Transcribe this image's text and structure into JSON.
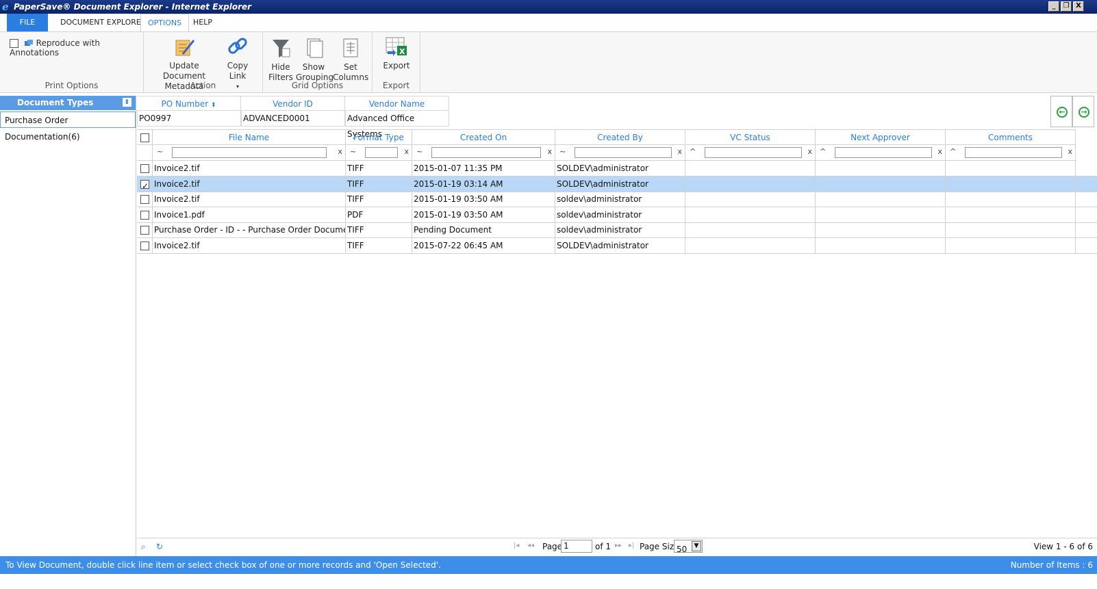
{
  "window": {
    "title": "PaperSave® Document Explorer - Internet Explorer",
    "controls": [
      "_",
      "❐",
      "X"
    ]
  },
  "menu": {
    "tabs": [
      {
        "label": "FILE",
        "active": false
      },
      {
        "label": "DOCUMENT EXPLORER",
        "active": false
      },
      {
        "label": "OPTIONS",
        "active": true
      },
      {
        "label": "HELP",
        "active": false
      }
    ]
  },
  "ribbon": {
    "print_options": {
      "reproduce_label": "Reproduce with Annotations",
      "reproduce_checked": false,
      "group_label": "Print Options"
    },
    "action": {
      "update_metadata_line1": "Update Document",
      "update_metadata_line2": "Metadata",
      "copy_link_line1": "Copy",
      "copy_link_line2": "Link",
      "copy_link_arrow": "▾",
      "group_label": "Action"
    },
    "grid_options": {
      "hide_filters_line1": "Hide",
      "hide_filters_line2": "Filters",
      "show_grouping_line1": "Show",
      "show_grouping_line2": "Grouping",
      "set_columns_line1": "Set",
      "set_columns_line2": "Columns",
      "group_label": "Grid Options"
    },
    "export": {
      "export_label": "Export",
      "group_label": "Export"
    }
  },
  "left_panel": {
    "header": "Document Types",
    "pin_icon": "pin-icon",
    "items": [
      "Purchase Order Documentation(6)"
    ]
  },
  "header_grid": {
    "columns": [
      "PO Number",
      "Vendor ID",
      "Vendor Name"
    ],
    "sort_glyph": "⬍",
    "values": [
      "PO0997",
      "ADVANCED0001",
      "Advanced Office Systems"
    ]
  },
  "nav": {
    "prev_icon": "arrow-left-circle-icon",
    "next_icon": "arrow-right-circle-icon",
    "prev_glyph": "←",
    "next_glyph": "→"
  },
  "grid": {
    "columns": [
      "File Name",
      "Format Type",
      "Created On",
      "Created By",
      "VC Status",
      "Next Approver",
      "Comments"
    ],
    "filter_ops": [
      "~",
      "~",
      "~",
      "~",
      "^",
      "^",
      "^"
    ],
    "filter_clear": "x",
    "rows": [
      {
        "checked": false,
        "selected": false,
        "file_name": "Invoice2.tif",
        "format": "TIFF",
        "created_on": "2015-01-07 11:35 PM",
        "created_by": "SOLDEV\\administrator",
        "vc_status": "",
        "next_approver": "",
        "comments": ""
      },
      {
        "checked": true,
        "selected": true,
        "file_name": "Invoice2.tif",
        "format": "TIFF",
        "created_on": "2015-01-19 03:14 AM",
        "created_by": "SOLDEV\\administrator",
        "vc_status": "",
        "next_approver": "",
        "comments": ""
      },
      {
        "checked": false,
        "selected": false,
        "file_name": "Invoice2.tif",
        "format": "TIFF",
        "created_on": "2015-01-19 03:50 AM",
        "created_by": "soldev\\administrator",
        "vc_status": "",
        "next_approver": "",
        "comments": ""
      },
      {
        "checked": false,
        "selected": false,
        "file_name": "Invoice1.pdf",
        "format": "PDF",
        "created_on": "2015-01-19 03:50 AM",
        "created_by": "soldev\\administrator",
        "vc_status": "",
        "next_approver": "",
        "comments": ""
      },
      {
        "checked": false,
        "selected": false,
        "file_name": "Purchase Order - ID - - Purchase Order Documentat...",
        "format": "TIFF",
        "created_on": "Pending Document",
        "created_by": "soldev\\administrator",
        "vc_status": "",
        "next_approver": "",
        "comments": ""
      },
      {
        "checked": false,
        "selected": false,
        "file_name": "Invoice2.tif",
        "format": "TIFF",
        "created_on": "2015-07-22 06:45 AM",
        "created_by": "SOLDEV\\administrator",
        "vc_status": "",
        "next_approver": "",
        "comments": ""
      }
    ]
  },
  "pager": {
    "search_icon": "search-icon",
    "refresh_icon": "refresh-icon",
    "first": "|◂",
    "prev": "◂◂",
    "page_label": "Page",
    "page_value": "1",
    "of_label": "of 1",
    "next": "▸▸",
    "last": "▸|",
    "page_size_label": "Page Size",
    "page_size_value": "50",
    "view_text": "View 1 - 6 of 6"
  },
  "status": {
    "message": "To View Document, double click line item or select check box of one or more records and 'Open Selected'.",
    "count": "Number of Items : 6"
  },
  "colors": {
    "accent": "#2b7de0",
    "status_bar": "#3d8ee8",
    "selected_row": "#b9d7f7",
    "panel_header": "#5b9ae4",
    "nav_green": "#2e9e3e"
  }
}
